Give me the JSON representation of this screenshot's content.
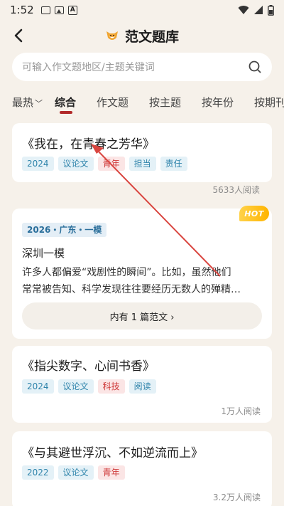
{
  "status_bar": {
    "time": "1:52"
  },
  "nav": {
    "title": "范文题库"
  },
  "search": {
    "placeholder": "可输入作文题地区/主题关键词"
  },
  "tabs": [
    {
      "label": "最热"
    },
    {
      "label": "综合"
    },
    {
      "label": "作文题"
    },
    {
      "label": "按主题"
    },
    {
      "label": "按年份"
    },
    {
      "label": "按期刊"
    }
  ],
  "cards": [
    {
      "title": "《我在，在青春之芳华》",
      "tags": [
        "2024",
        "议论文",
        "青年",
        "担当",
        "责任"
      ],
      "reads": "5633人阅读"
    },
    {
      "badge": "HOT",
      "tag": "2026・广东・一模",
      "subtitle": "深圳一模",
      "body_line1": "许多人都偏爱“戏剧性的瞬间”。比如，虽然他们",
      "body_line2": "常常被告知、科学发现往往要经历无数人的殚精…",
      "button_label": "内有 1 篇范文 ›"
    },
    {
      "title": "《指尖数字、心间书香》",
      "tags": [
        "2024",
        "议论文",
        "科技",
        "阅读"
      ],
      "reads": "1万人阅读"
    },
    {
      "title": "《与其避世浮沉、不如逆流而上》",
      "tags": [
        "2022",
        "议论文",
        "青年"
      ],
      "reads": "3.2万人阅读"
    }
  ],
  "colors": {
    "accent": "#b22a2a",
    "background": "#f6f1ea",
    "annotation_arrow": "#d9453f"
  }
}
